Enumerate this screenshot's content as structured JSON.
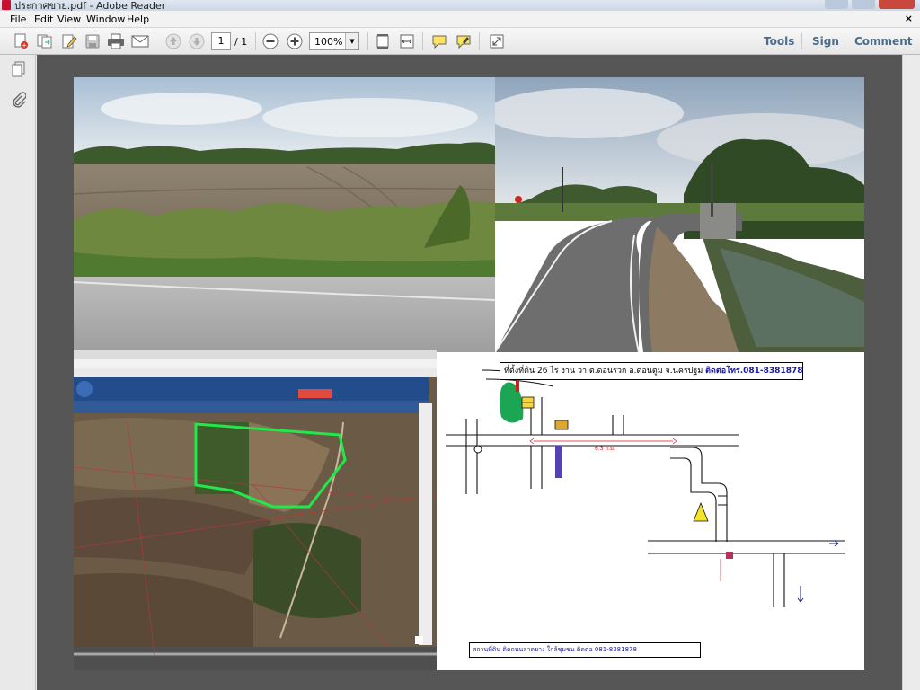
{
  "window": {
    "title": "ประกาศขาย.pdf - Adobe Reader",
    "close_symbol": "×"
  },
  "menu": {
    "items": [
      "File",
      "Edit",
      "View",
      "Window",
      "Help"
    ]
  },
  "toolbar": {
    "page_current": "1",
    "page_total": "/ 1",
    "zoom": "100%",
    "zoom_dropdown_symbol": "▼",
    "tools_label": "Tools",
    "sign_label": "Sign",
    "comment_label": "Comment"
  },
  "icons": {
    "create": "create-pdf-icon",
    "combine": "combine-files-icon",
    "edit": "edit-pdf-icon",
    "save": "save-icon",
    "print": "print-icon",
    "email": "email-icon",
    "prev": "previous-page-icon",
    "next": "next-page-icon",
    "zoom_out": "zoom-out-icon",
    "zoom_in": "zoom-in-icon",
    "fit_page": "fit-page-icon",
    "fit_width": "fit-width-icon",
    "comment": "sticky-note-icon",
    "highlight": "highlight-icon",
    "fullscreen": "fullscreen-icon",
    "pages": "page-thumbnails-icon",
    "attachments": "attachments-icon"
  },
  "map": {
    "header_text": "ที่ตั้งที่ดิน 26 ไร่ งาน วา ต.ดอนรวก อ.ดอนตูม จ.นครปฐม",
    "header_contact": "ติดต่อโทร.081-8381878",
    "distance_label": "6.3 ก.ม.",
    "footer_text": "สถานที่ดิน ติดถนนลาดยาง ใกล้ชุมชน ติดต่อ 081-8381878"
  },
  "colors": {
    "accent_link": "#4b6b8c",
    "map_text": "#1a1a9a",
    "parcel_outline": "#22e84a"
  }
}
